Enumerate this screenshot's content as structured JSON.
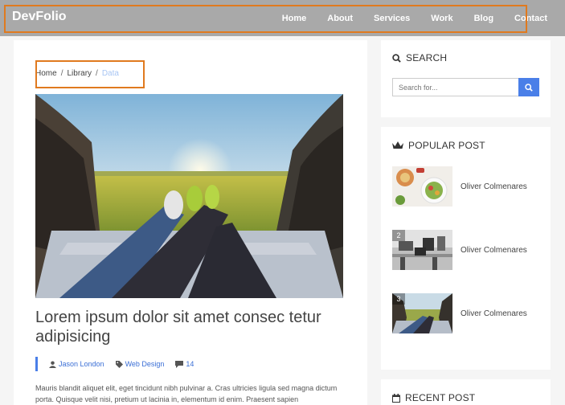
{
  "brand": "DevFolio",
  "nav": [
    "Home",
    "About",
    "Services",
    "Work",
    "Blog",
    "Contact"
  ],
  "breadcrumb": {
    "items": [
      "Home",
      "Library"
    ],
    "active": "Data",
    "separator": "/"
  },
  "post": {
    "title": "Lorem ipsum dolor sit amet consec tetur adipisicing",
    "author": "Jason London",
    "category": "Web Design",
    "comments": "14",
    "excerpt": "Mauris blandit aliquet elit, eget tincidunt nibh pulvinar a. Cras ultricies ligula sed magna dictum porta. Quisque velit nisi, pretium ut lacinia in, elementum id enim. Praesent sapien"
  },
  "sidebar": {
    "search": {
      "title": "SEARCH",
      "placeholder": "Search for..."
    },
    "popular": {
      "title": "POPULAR POST",
      "items": [
        {
          "num": "",
          "name": "Oliver Colmenares"
        },
        {
          "num": "2",
          "name": "Oliver Colmenares"
        },
        {
          "num": "3",
          "name": "Oliver Colmenares"
        }
      ]
    },
    "recent": {
      "title": "RECENT POST"
    }
  },
  "colors": {
    "navbar": "#a9a9a9",
    "accent": "#4a7fe8",
    "highlight": "#e07a1f"
  }
}
